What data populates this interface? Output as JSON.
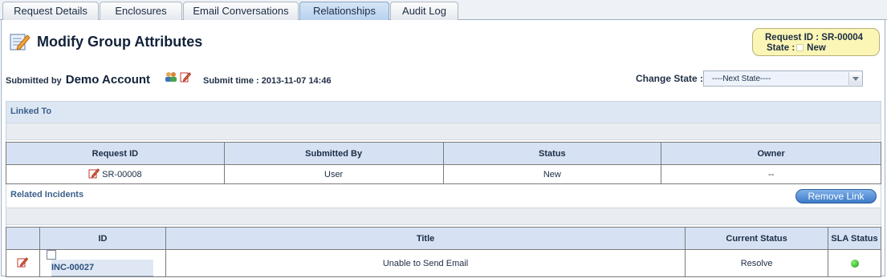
{
  "tabs": [
    {
      "label": "Request Details",
      "active": false
    },
    {
      "label": "Enclosures",
      "active": false
    },
    {
      "label": "Email Conversations",
      "active": false
    },
    {
      "label": "Relationships",
      "active": true
    },
    {
      "label": "Audit Log",
      "active": false
    }
  ],
  "header": {
    "title": "Modify Group Attributes",
    "request_id_line": "Request ID : SR-00004",
    "state_label": "State :",
    "state_value": "New",
    "submitted_by_label": "Submitted by",
    "submitted_by_name": "Demo Account",
    "submit_time": "Submit time : 2013-11-07 14:46",
    "change_state_label": "Change State :",
    "change_state_value": "----Next State----"
  },
  "linked_to": {
    "title": "Linked To",
    "columns": [
      "Request ID",
      "Submitted By",
      "Status",
      "Owner"
    ],
    "rows": [
      {
        "request_id": "SR-00008",
        "submitted_by": "User",
        "status": "New",
        "owner": "--"
      }
    ]
  },
  "related_incidents": {
    "title": "Related Incidents",
    "remove_link_label": "Remove Link",
    "columns": [
      "ID",
      "Title",
      "Current Status",
      "SLA Status"
    ],
    "rows": [
      {
        "id": "INC-00027",
        "title": "Unable to Send Email",
        "current_status": "Resolve",
        "sla_color": "#1ca01c"
      }
    ]
  },
  "colors": {
    "active_tab": "#b9d2ef",
    "section_header": "#dde7f3",
    "request_box": "#fbf6b5",
    "button": "#3e7bc8"
  },
  "icons": [
    "page-edit-icon",
    "users-icon",
    "edit-icon",
    "chevron-down-icon",
    "sla-status-icon"
  ]
}
